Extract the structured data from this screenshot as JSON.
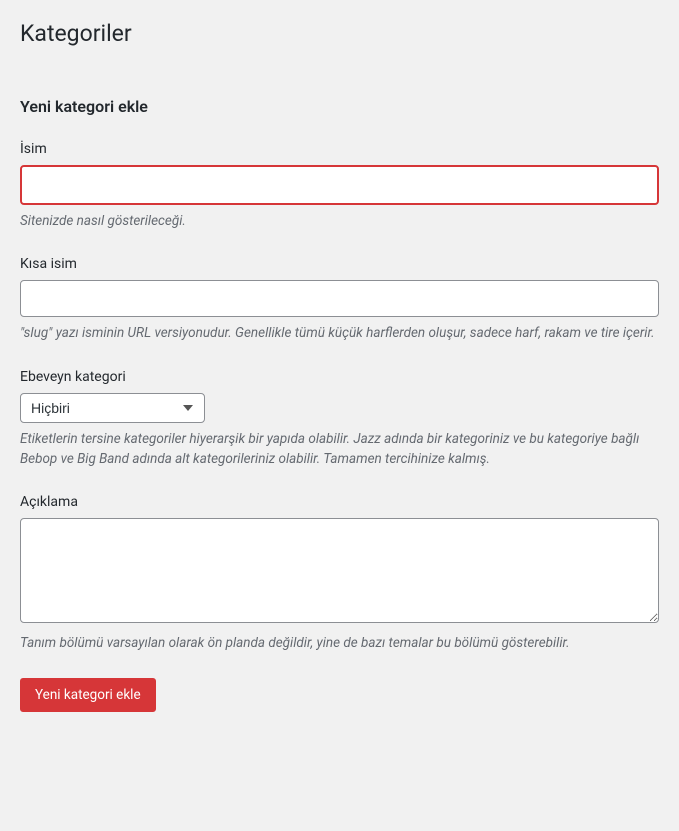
{
  "page": {
    "title": "Kategoriler",
    "subtitle": "Yeni kategori ekle"
  },
  "fields": {
    "name": {
      "label": "İsim",
      "value": "",
      "description": "Sitenizde nasıl gösterileceği."
    },
    "slug": {
      "label": "Kısa isim",
      "value": "",
      "description": "\"slug\" yazı isminin URL versiyonudur. Genellikle tümü küçük harflerden oluşur, sadece harf, rakam ve tire içerir."
    },
    "parent": {
      "label": "Ebeveyn kategori",
      "selected": "Hiçbiri",
      "description": "Etiketlerin tersine kategoriler hiyerarşik bir yapıda olabilir. Jazz adında bir kategoriniz ve bu kategoriye bağlı Bebop ve Big Band adında alt kategorileriniz olabilir. Tamamen tercihinize kalmış."
    },
    "description": {
      "label": "Açıklama",
      "value": "",
      "description": "Tanım bölümü varsayılan olarak ön planda değildir, yine de bazı temalar bu bölümü gösterebilir."
    }
  },
  "submit": {
    "label": "Yeni kategori ekle"
  }
}
